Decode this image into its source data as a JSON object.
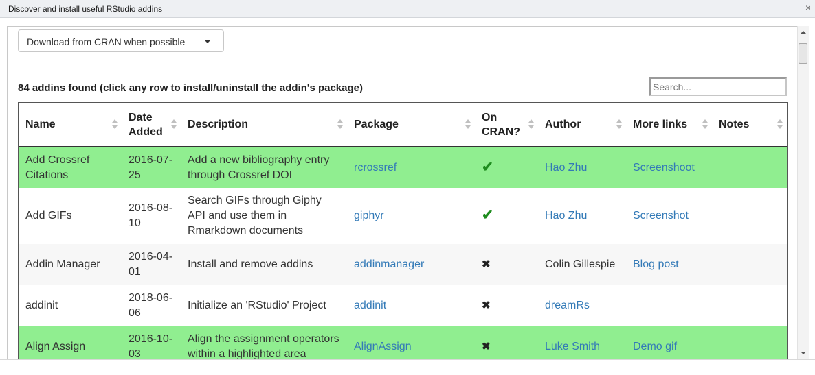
{
  "dialog": {
    "title": "Discover and install useful RStudio addins",
    "close_icon": "×"
  },
  "source_select": {
    "value": "Download from CRAN when possible"
  },
  "summary": "84 addins found (click any row to install/uninstall the addin's package)",
  "search": {
    "placeholder": "Search..."
  },
  "table": {
    "columns": [
      "Name",
      "Date Added",
      "Description",
      "Package",
      "On CRAN?",
      "Author",
      "More links",
      "Notes"
    ],
    "rows": [
      {
        "name": "Add Crossref Citations",
        "date": "2016-07-25",
        "description": "Add a new bibliography entry through Crossref DOI",
        "package": "rcrossref",
        "on_cran": "✔",
        "author": "Hao Zhu",
        "more_links": "Screenshoot",
        "notes": "",
        "installed": true
      },
      {
        "name": "Add GIFs",
        "date": "2016-08-10",
        "description": "Search GIFs through Giphy API and use them in Rmarkdown documents",
        "package": "giphyr",
        "on_cran": "✔",
        "author": "Hao Zhu",
        "more_links": "Screenshot",
        "notes": "",
        "installed": false
      },
      {
        "name": "Addin Manager",
        "date": "2016-04-01",
        "description": "Install and remove addins",
        "package": "addinmanager",
        "on_cran": "✖",
        "author": "Colin Gillespie",
        "more_links": "Blog post",
        "notes": "",
        "installed": false
      },
      {
        "name": "addinit",
        "date": "2018-06-06",
        "description": "Initialize an 'RStudio' Project",
        "package": "addinit",
        "on_cran": "✖",
        "author": "dreamRs",
        "more_links": "",
        "notes": "",
        "installed": false
      },
      {
        "name": "Align Assign",
        "date": "2016-10-03",
        "description": "Align the assignment operators within a highlighted area",
        "package": "AlignAssign",
        "on_cran": "✖",
        "author": "Luke Smith",
        "more_links": "Demo gif",
        "notes": "",
        "installed": true
      }
    ]
  },
  "colors": {
    "installed_row": "#90ee90",
    "link": "#337ab7",
    "check": "#1e8c1e"
  },
  "icons": {
    "sort": "sort-both-icon",
    "check": "check-icon",
    "cross": "cross-icon"
  }
}
